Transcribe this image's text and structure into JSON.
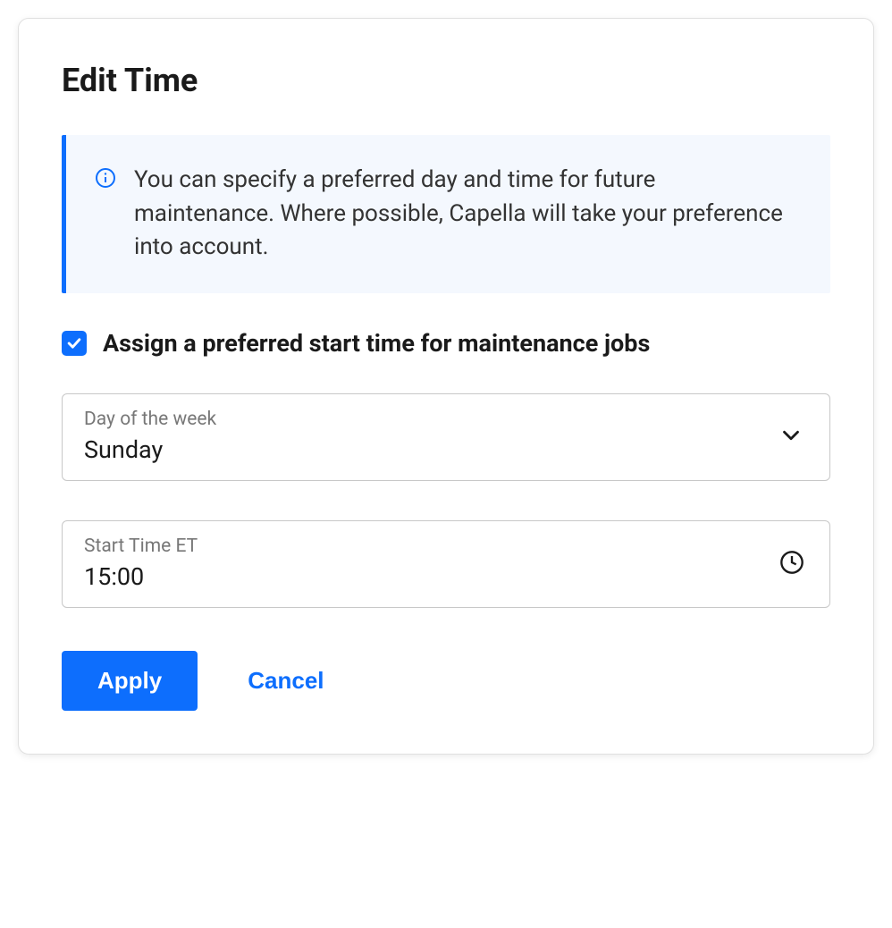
{
  "title": "Edit Time",
  "info_text": "You can specify a preferred day and time for future maintenance. Where possible, Capella will take your preference into account.",
  "checkbox": {
    "checked": true,
    "label": "Assign a preferred start time for maintenance jobs"
  },
  "day_field": {
    "label": "Day of the week",
    "value": "Sunday"
  },
  "time_field": {
    "label": "Start Time ET",
    "value": "15:00"
  },
  "actions": {
    "apply": "Apply",
    "cancel": "Cancel"
  },
  "colors": {
    "primary": "#0d6efd",
    "banner_bg": "#f4f8fe"
  }
}
